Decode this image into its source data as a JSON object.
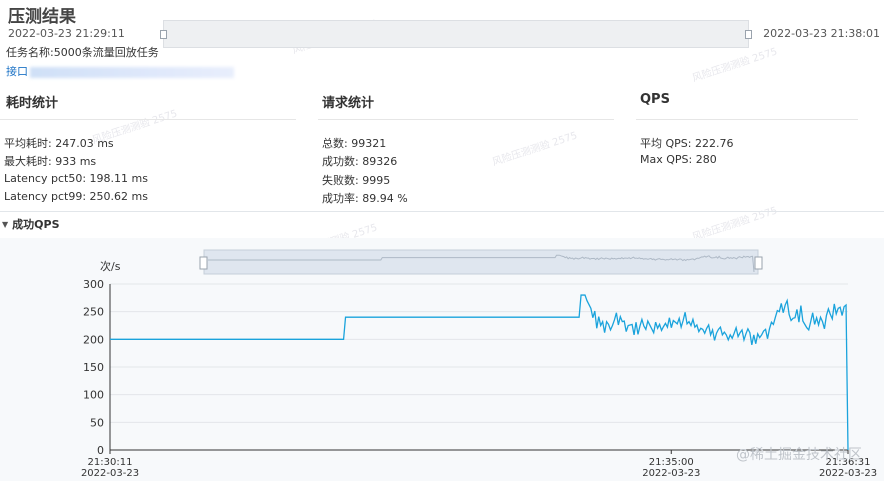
{
  "page": {
    "title": "压测结果",
    "time_start": "2022-03-23 21:29:11",
    "time_end": "2022-03-23 21:38:01",
    "task_name": "任务名称:5000条流量回放任务",
    "api_label": "接口"
  },
  "sections": {
    "latency": {
      "heading": "耗时统计",
      "lines": [
        "平均耗时: 247.03 ms",
        "最大耗时: 933 ms",
        "Latency pct50: 198.11 ms",
        "Latency pct99: 250.62 ms"
      ]
    },
    "requests": {
      "heading": "请求统计",
      "lines": [
        "总数: 99321",
        "成功数: 89326",
        "失败数: 9995",
        "成功率: 89.94 %"
      ]
    },
    "qps": {
      "heading": "QPS",
      "lines": [
        "平均 QPS: 222.76",
        "Max QPS: 280"
      ]
    }
  },
  "qps_section": {
    "title": "成功QPS"
  },
  "watermark": {
    "site": "@稀土掘金技术社区"
  },
  "colors": {
    "line": "#1aa3dc",
    "link": "#1e73c6"
  },
  "chart_data": {
    "type": "line",
    "title": "成功QPS",
    "ylabel": "次/s",
    "ylim": [
      0,
      300
    ],
    "yticks": [
      0,
      50,
      100,
      150,
      200,
      250,
      300
    ],
    "grid": true,
    "x_ticks": [
      {
        "time": "21:30:11",
        "date": "2022-03-23"
      },
      {
        "time": "21:35:00",
        "date": "2022-03-23"
      },
      {
        "time": "21:36:31",
        "date": "2022-03-23"
      }
    ],
    "x_start_time": "21:30:11",
    "x_end_time": "21:36:31",
    "series": [
      {
        "values": [
          200,
          200,
          200,
          200,
          200,
          200,
          200,
          200,
          200,
          200,
          200,
          200,
          200,
          200,
          200,
          200,
          200,
          200,
          200,
          200,
          200,
          200,
          200,
          200,
          200,
          200,
          200,
          200,
          200,
          200,
          200,
          200,
          200,
          200,
          200,
          200,
          200,
          200,
          200,
          200,
          200,
          200,
          200,
          200,
          200,
          200,
          200,
          200,
          200,
          200,
          200,
          200,
          200,
          200,
          200,
          200,
          200,
          200,
          200,
          200,
          200,
          200,
          200,
          200,
          200,
          200,
          200,
          200,
          200,
          200,
          200,
          200,
          200,
          200,
          200,
          200,
          200,
          200,
          200,
          200,
          200,
          200,
          200,
          200,
          200,
          200,
          200,
          200,
          200,
          200,
          200,
          200,
          200,
          200,
          200,
          200,
          200,
          200,
          200,
          200,
          200,
          200,
          200,
          200,
          200,
          200,
          200,
          200,
          200,
          200,
          200,
          200,
          200,
          200,
          200,
          200,
          200,
          200,
          200,
          200,
          240,
          240,
          240,
          240,
          240,
          240,
          240,
          240,
          240,
          240,
          240,
          240,
          240,
          240,
          240,
          240,
          240,
          240,
          240,
          240,
          240,
          240,
          240,
          240,
          240,
          240,
          240,
          240,
          240,
          240,
          240,
          240,
          240,
          240,
          240,
          240,
          240,
          240,
          240,
          240,
          240,
          240,
          240,
          240,
          240,
          240,
          240,
          240,
          240,
          240,
          240,
          240,
          240,
          240,
          240,
          240,
          240,
          240,
          240,
          240,
          240,
          240,
          240,
          240,
          240,
          240,
          240,
          240,
          240,
          240,
          240,
          240,
          240,
          240,
          240,
          240,
          240,
          240,
          240,
          240,
          240,
          240,
          240,
          240,
          240,
          240,
          240,
          240,
          240,
          240,
          240,
          240,
          240,
          240,
          240,
          240,
          240,
          240,
          240,
          240,
          240,
          240,
          240,
          240,
          240,
          240,
          240,
          240,
          240,
          240,
          240,
          240,
          240,
          240,
          240,
          240,
          240,
          240,
          240,
          240,
          280,
          280,
          280,
          270,
          263,
          256,
          239,
          251,
          220,
          241,
          225,
          232,
          212,
          232,
          227,
          217,
          225,
          235,
          248,
          226,
          241,
          232,
          233,
          214,
          225,
          226,
          227,
          208,
          231,
          209,
          224,
          236,
          224,
          218,
          233,
          226,
          219,
          212,
          231,
          220,
          227,
          216,
          223,
          229,
          222,
          239,
          221,
          234,
          231,
          228,
          238,
          222,
          234,
          249,
          228,
          232,
          225,
          236,
          222,
          226,
          214,
          220,
          218,
          211,
          220,
          226,
          208,
          217,
          198,
          211,
          218,
          222,
          208,
          213,
          208,
          199,
          208,
          202,
          211,
          221,
          205,
          212,
          217,
          199,
          210,
          219,
          212,
          190,
          208,
          192,
          210,
          203,
          208,
          215,
          218,
          201,
          219,
          231,
          227,
          240,
          252,
          250,
          265,
          248,
          262,
          270,
          245,
          234,
          238,
          239,
          254,
          231,
          261,
          233,
          227,
          221,
          217,
          232,
          248,
          227,
          239,
          226,
          240,
          232,
          219,
          243,
          255,
          245,
          237,
          264,
          246,
          256,
          258,
          243,
          259,
          262,
          0
        ]
      }
    ]
  }
}
